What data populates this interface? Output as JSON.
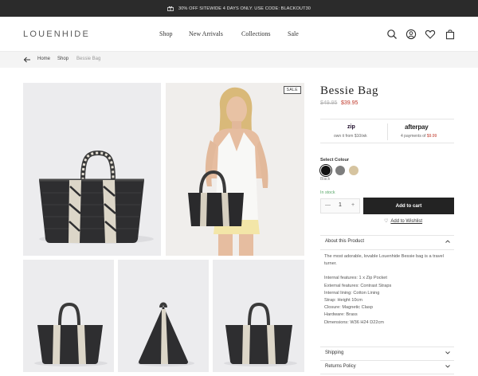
{
  "promo": {
    "text": "30% OFF SITEWIDE 4 DAYS ONLY. USE CODE: BLACKOUT30",
    "icon": "gift-icon"
  },
  "header": {
    "logo": "LOUENHIDE",
    "nav": [
      "Shop",
      "New Arrivals",
      "Collections",
      "Sale"
    ],
    "icons": [
      "search-icon",
      "account-icon",
      "heart-icon",
      "bag-icon"
    ]
  },
  "breadcrumb": {
    "items": [
      "Home",
      "Shop",
      "Bessie Bag"
    ],
    "back_icon": "arrow-left-icon"
  },
  "gallery": {
    "sale_badge": "SALE"
  },
  "product": {
    "title": "Bessie Bag",
    "old_price": "$49.95",
    "price": "$39.95",
    "zip": {
      "logo": "zip",
      "text": "own it from $10/wk"
    },
    "afterpay": {
      "logo": "afterpay",
      "text_prefix": "4 payments of ",
      "amount": "$9.99"
    },
    "colour_label": "Select Colour",
    "colours": [
      "#111111",
      "#7d7d7d",
      "#d6c4a0"
    ],
    "selected_colour": "Black",
    "stock": "In stock",
    "quantity": "1",
    "qty_minus": "—",
    "qty_plus": "+",
    "add_to_cart": "Add to cart",
    "wishlist": "Add to Wishlist"
  },
  "accordion": {
    "about": {
      "title": "About this Product",
      "intro": "The most adorable, lovable Louenhide Bessie bag is a travel turner.",
      "details": [
        "Internal features: 1 x Zip Pocket",
        "External features: Contrast Straps",
        "Internal lining: Cotton Lining",
        "Strap: Height 10cm",
        "Closure: Magnetic Clasp",
        "Hardware: Brass",
        "Dimensions: W36 H24 D22cm"
      ]
    },
    "shipping": {
      "title": "Shipping"
    },
    "returns": {
      "title": "Returns Policy"
    }
  }
}
